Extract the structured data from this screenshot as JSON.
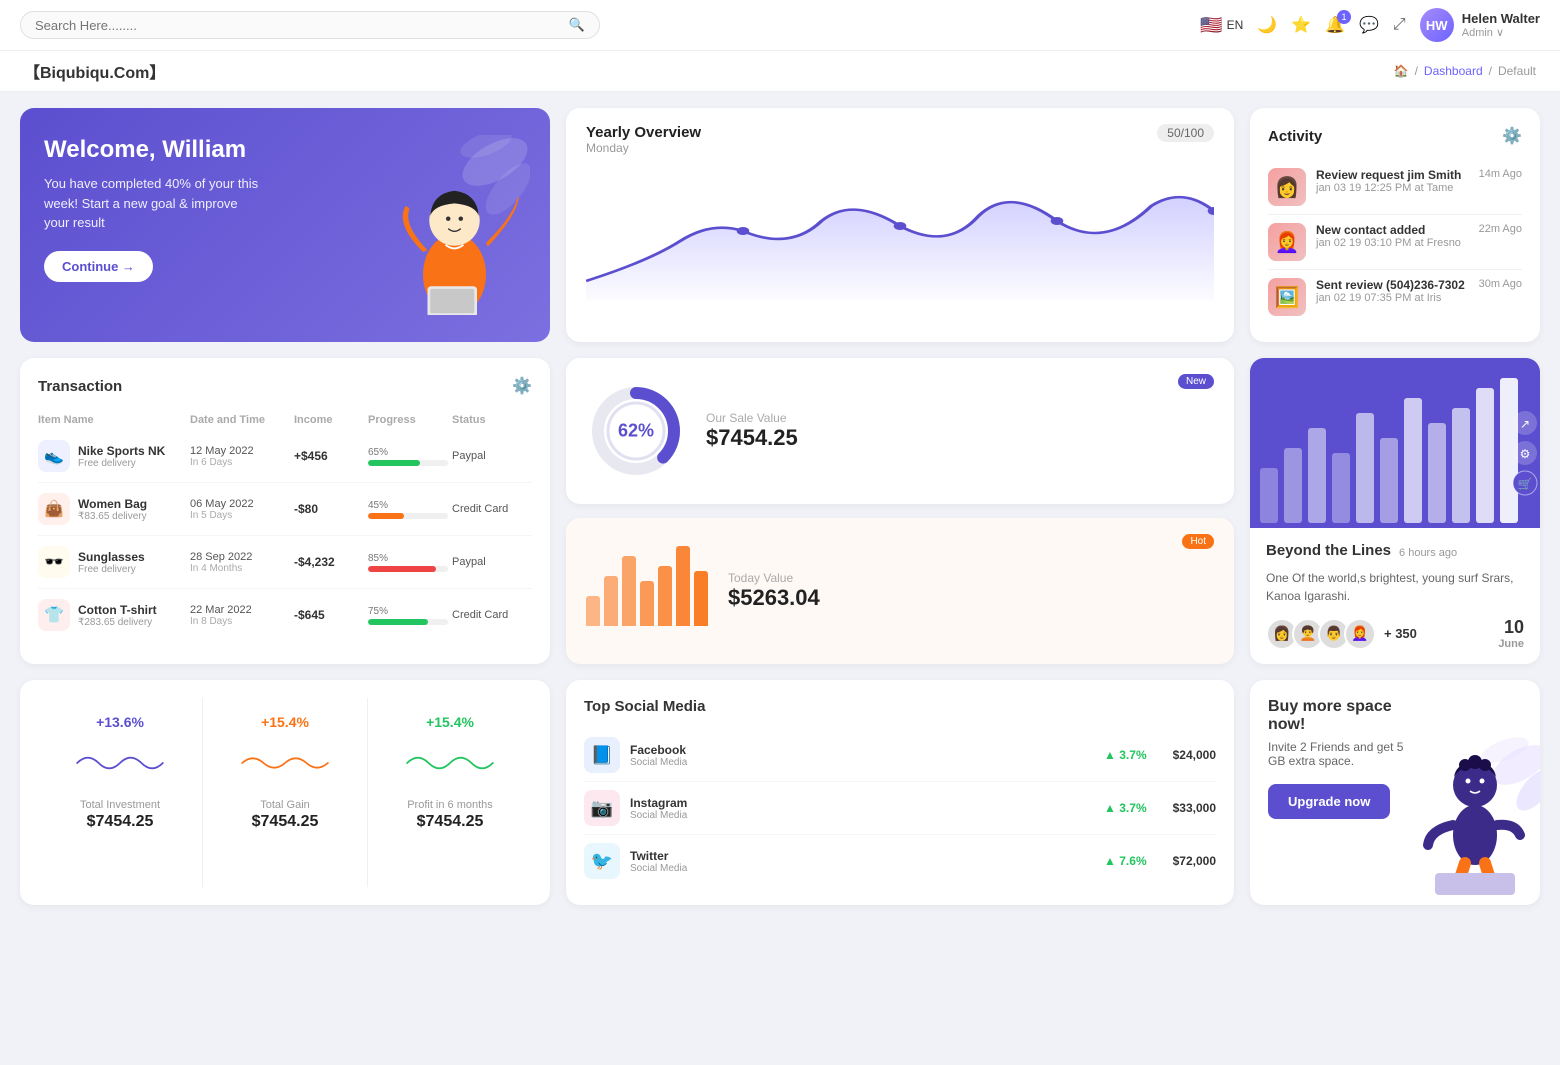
{
  "topnav": {
    "search_placeholder": "Search Here........",
    "language": "EN",
    "notification_count": "1",
    "user_name": "Helen Walter",
    "user_role": "Admin ∨"
  },
  "breadcrumb": {
    "brand": "【Biqubiqu.Com】",
    "home_icon": "🏠",
    "dashboard": "Dashboard",
    "current": "Default"
  },
  "welcome": {
    "title": "Welcome, William",
    "subtitle": "You have completed 40% of your this week! Start a new goal & improve your result",
    "button": "Continue →"
  },
  "yearly_overview": {
    "title": "Yearly Overview",
    "subtitle": "Monday",
    "progress": "50/100"
  },
  "activity": {
    "title": "Activity",
    "items": [
      {
        "title": "Review request jim Smith",
        "subtitle": "jan 03 19 12:25 PM at Tame",
        "time": "14m Ago",
        "emoji": "👩"
      },
      {
        "title": "New contact added",
        "subtitle": "jan 02 19 03:10 PM at Fresno",
        "time": "22m Ago",
        "emoji": "👩‍🦰"
      },
      {
        "title": "Sent review (504)236-7302",
        "subtitle": "jan 02 19 07:35 PM at Iris",
        "time": "30m Ago",
        "emoji": "🖼️"
      }
    ]
  },
  "transaction": {
    "title": "Transaction",
    "columns": [
      "Item Name",
      "Date and Time",
      "Income",
      "Progress",
      "Status"
    ],
    "rows": [
      {
        "name": "Nike Sports NK",
        "sub": "Free delivery",
        "emoji": "👟",
        "icon_bg": "#eef0ff",
        "date": "12 May 2022",
        "date_sub": "In 6 Days",
        "income": "+$456",
        "income_type": "pos",
        "progress": 65,
        "progress_color": "#22c55e",
        "status": "Paypal"
      },
      {
        "name": "Women Bag",
        "sub": "₹83.65 delivery",
        "emoji": "👜",
        "icon_bg": "#fff0ee",
        "date": "06 May 2022",
        "date_sub": "In 5 Days",
        "income": "-$80",
        "income_type": "neg",
        "progress": 45,
        "progress_color": "#f97316",
        "status": "Credit Card"
      },
      {
        "name": "Sunglasses",
        "sub": "Free delivery",
        "emoji": "🕶️",
        "icon_bg": "#fffbee",
        "date": "28 Sep 2022",
        "date_sub": "In 4 Months",
        "income": "-$4,232",
        "income_type": "neg",
        "progress": 85,
        "progress_color": "#ef4444",
        "status": "Paypal"
      },
      {
        "name": "Cotton T-shirt",
        "sub": "₹283.65 delivery",
        "emoji": "👕",
        "icon_bg": "#ffeeee",
        "date": "22 Mar 2022",
        "date_sub": "In 8 Days",
        "income": "-$645",
        "income_type": "neg",
        "progress": 75,
        "progress_color": "#22c55e",
        "status": "Credit Card"
      }
    ]
  },
  "sale_value": {
    "badge": "New",
    "donut_pct": "62%",
    "label": "Our Sale Value",
    "value": "$7454.25",
    "donut_filled": 62
  },
  "today_value": {
    "badge": "Hot",
    "label": "Today Value",
    "value": "$5263.04",
    "bars": [
      30,
      50,
      70,
      45,
      60,
      80,
      55
    ]
  },
  "beyond": {
    "title": "Beyond the Lines",
    "time_ago": "6 hours ago",
    "desc": "One Of the world,s brightest, young surf Srars, Kanoa Igarashi.",
    "plus_count": "+ 350",
    "date": "10",
    "month": "June",
    "avatars": [
      "👩",
      "🧑‍🦱",
      "👨",
      "👩‍🦰"
    ]
  },
  "stats": [
    {
      "pct": "+13.6%",
      "color": "purple",
      "label": "Total Investment",
      "value": "$7454.25"
    },
    {
      "pct": "+15.4%",
      "color": "orange",
      "label": "Total Gain",
      "value": "$7454.25"
    },
    {
      "pct": "+15.4%",
      "color": "green",
      "label": "Profit in 6 months",
      "value": "$7454.25"
    }
  ],
  "social_media": {
    "title": "Top Social Media",
    "items": [
      {
        "name": "Facebook",
        "sub": "Social Media",
        "pct": "3.7%",
        "amount": "$24,000",
        "emoji": "📘",
        "color": "fb"
      },
      {
        "name": "Instagram",
        "sub": "Social Media",
        "pct": "3.7%",
        "amount": "$33,000",
        "emoji": "📷",
        "color": "ig"
      },
      {
        "name": "Twitter",
        "sub": "Social Media",
        "pct": "7.6%",
        "amount": "$72,000",
        "emoji": "🐦",
        "color": "tw"
      }
    ]
  },
  "buy_space": {
    "title": "Buy more space now!",
    "desc": "Invite 2 Friends and get 5 GB extra space.",
    "button": "Upgrade now"
  }
}
